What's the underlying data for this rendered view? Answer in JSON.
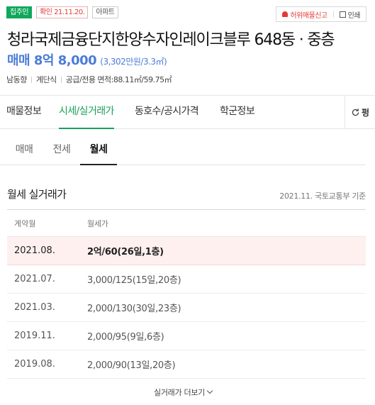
{
  "badges": {
    "owner": "집주인",
    "confirm": "확인 21.11.20.",
    "type": "아파트"
  },
  "actions": {
    "report": "허위매물신고",
    "print": "인쇄"
  },
  "listing": {
    "title": "청라국제금융단지한양수자인레이크블루 648동 · 중층",
    "price_main": "매매 8억 8,000",
    "price_sub": "(3,302만원/3.3㎡)",
    "specs": [
      "남동향",
      "계단식",
      "공급/전용 면적:88.11㎡/59.75㎡"
    ]
  },
  "main_tabs": [
    "매물정보",
    "시세/실거래가",
    "동호수/공시가격",
    "학군정보"
  ],
  "refresh_label": "펑",
  "sub_tabs": [
    "매매",
    "전세",
    "월세"
  ],
  "section": {
    "title": "월세 실거래가",
    "source": "2021.11. 국토교통부 기준"
  },
  "table": {
    "headers": [
      "계약월",
      "월세가"
    ],
    "rows": [
      {
        "month": "2021.08.",
        "price": "2억/60(26일,1층)"
      },
      {
        "month": "2021.07.",
        "price": "3,000/125(15일,20층)"
      },
      {
        "month": "2021.03.",
        "price": "2,000/130(30일,23층)"
      },
      {
        "month": "2019.11.",
        "price": "2,000/95(9일,6층)"
      },
      {
        "month": "2019.08.",
        "price": "2,000/90(13일,20층)"
      }
    ]
  },
  "more_label": "실거래가 더보기",
  "colors": {
    "accent_green": "#1a9f58",
    "price_blue": "#4a7dd6",
    "badge_green": "#0fa85a",
    "alert_red": "#e53935",
    "highlight_row": "#fdf0ef"
  }
}
